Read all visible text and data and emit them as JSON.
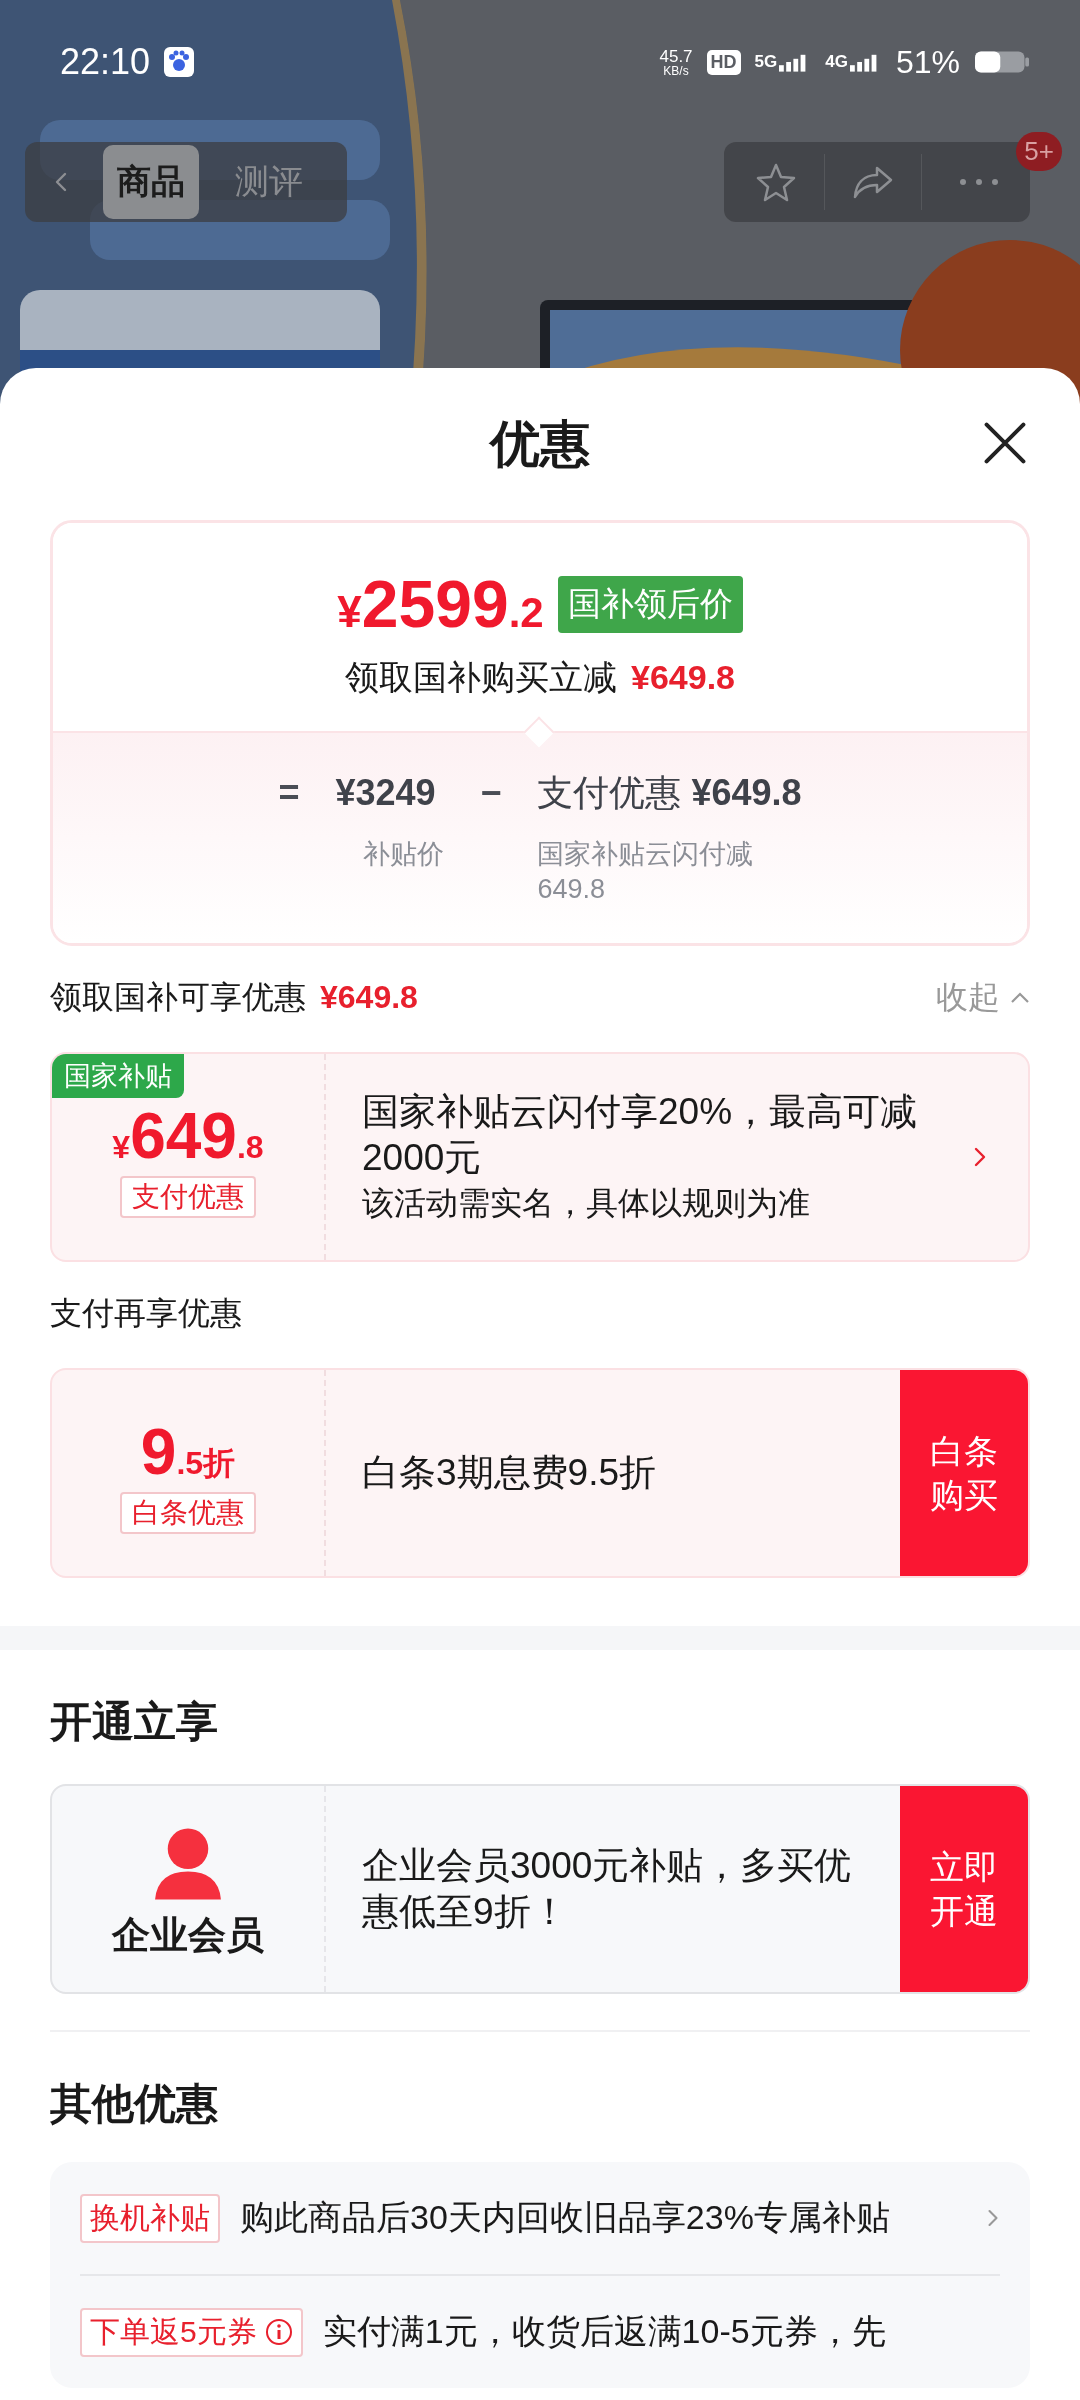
{
  "status_bar": {
    "time": "22:10",
    "net_speed": "45.7",
    "net_unit": "KB/s",
    "indicators": [
      "HD",
      "5G",
      "4G"
    ],
    "battery": "51%"
  },
  "nav": {
    "tabs": [
      {
        "label": "商品",
        "selected": true
      },
      {
        "label": "测评",
        "selected": false
      }
    ],
    "badge": "5+"
  },
  "sheet": {
    "title": "优惠",
    "summary": {
      "currency": "¥",
      "price_int": "2599",
      "price_dec": ".2",
      "price_tag": "国补领后价",
      "subtitle": "领取国补购买立减",
      "subtitle_amount": "¥649.8",
      "equals": "=",
      "base_price": "¥3249",
      "minus": "−",
      "deduction_label": "支付优惠",
      "deduction_amount": "¥649.8",
      "base_caption": "补贴价",
      "deduction_caption": "国家补贴云闪付减 649.8"
    },
    "groups": [
      {
        "heading": "领取国补可享优惠",
        "amount": "¥649.8",
        "toggle": "收起",
        "expanded": true,
        "coupons": [
          {
            "kind": "arrow",
            "corner_tag": "国家补贴",
            "currency": "¥",
            "value": "649",
            "value_small": ".8",
            "label": "支付优惠",
            "title": "国家补贴云闪付享20%，最高可减2000元",
            "note": "该活动需实名，具体以规则为准"
          }
        ]
      },
      {
        "heading": "支付再享优惠",
        "coupons": [
          {
            "kind": "button",
            "value": "9",
            "value_small": ".5折",
            "label": "白条优惠",
            "title": "白条3期息费9.5折",
            "button": "白条购买"
          }
        ]
      }
    ],
    "membership": {
      "heading": "开通立享",
      "coupon": {
        "kind": "member",
        "name": "企业会员",
        "title": "企业会员3000元补贴，多买优惠低至9折！",
        "button": "立即开通"
      }
    },
    "other": {
      "heading": "其他优惠",
      "items": [
        {
          "tag": "换机补贴",
          "info": false,
          "text": "购此商品后30天内回收旧品享23%专属补贴",
          "arrow": true
        },
        {
          "tag": "下单返5元券",
          "info": true,
          "text": "实付满1元，收货后返满10-5元券，先",
          "arrow": false
        }
      ]
    }
  }
}
